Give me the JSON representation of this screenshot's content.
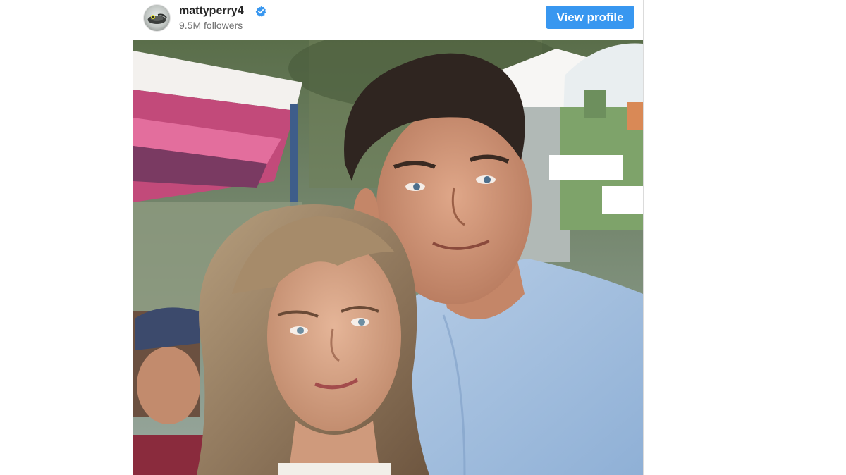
{
  "post_header": {
    "username": "mattyperry4",
    "verified_icon": "verified-badge-icon",
    "followers": "9.5M followers",
    "view_profile_label": "View profile"
  },
  "photo": {
    "icon": "photo-image"
  },
  "colors": {
    "button_blue": "#3897f0",
    "verified_blue": "#3897f0",
    "username_text": "#262626",
    "muted_text": "#6f6f6f",
    "border": "#dbdbdb"
  }
}
